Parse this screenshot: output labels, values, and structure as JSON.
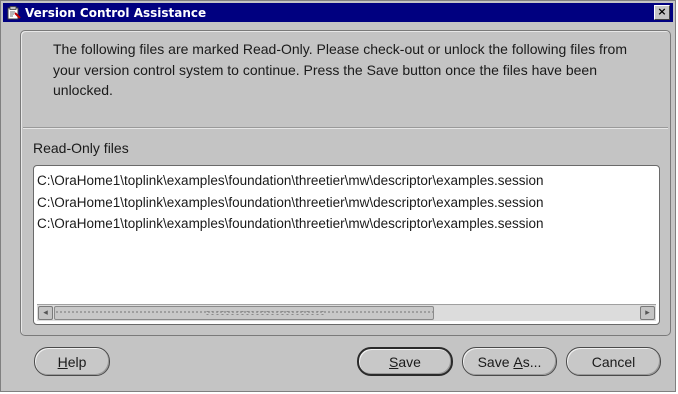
{
  "window": {
    "title": "Version Control Assistance",
    "close_label": "×"
  },
  "message": {
    "text": "The following files are marked Read-Only. Please check-out or unlock the following files from your version control system to continue. Press the Save button once the files have been unlocked."
  },
  "files_section": {
    "label": "Read-Only files",
    "items": [
      "C:\\OraHome1\\toplink\\examples\\foundation\\threetier\\mw\\descriptor\\examples.session",
      "C:\\OraHome1\\toplink\\examples\\foundation\\threetier\\mw\\descriptor\\examples.session",
      "C:\\OraHome1\\toplink\\examples\\foundation\\threetier\\mw\\descriptor\\examples.session"
    ],
    "scroll_left_glyph": "◂",
    "scroll_right_glyph": "▸"
  },
  "buttons": {
    "help": {
      "mnemonic": "H",
      "rest": "elp"
    },
    "save": {
      "mnemonic": "S",
      "rest": "ave"
    },
    "save_as": {
      "prefix": "Save ",
      "mnemonic": "A",
      "rest": "s..."
    },
    "cancel": {
      "label": "Cancel"
    }
  },
  "colors": {
    "titlebar": "#000080",
    "dialog_bg": "#c4c4c4",
    "list_bg": "#ffffff"
  },
  "icons": {
    "title": "version-control-icon",
    "close": "close-icon"
  }
}
